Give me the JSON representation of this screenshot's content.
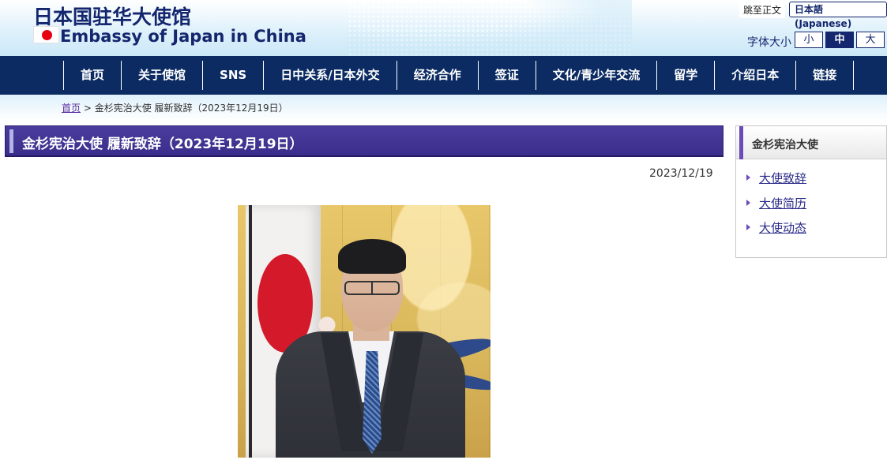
{
  "header": {
    "title_cn": "日本国驻华大使馆",
    "title_en": "Embassy of Japan in China",
    "skip_link": "跳至正文",
    "lang_button": "日本語 (Japanese)",
    "font_size_label": "字体大小",
    "font_sizes": [
      "小",
      "中",
      "大"
    ]
  },
  "nav": {
    "items": [
      "首页",
      "关于使馆",
      "SNS",
      "日中关系/日本外交",
      "经济合作",
      "签证",
      "文化/青少年交流",
      "留学",
      "介绍日本",
      "链接"
    ]
  },
  "breadcrumb": {
    "home": "首页",
    "separator": ">",
    "current": "金杉宪治大使 履新致辞（2023年12月19日）"
  },
  "main": {
    "heading": "金杉宪治大使 履新致辞（2023年12月19日）",
    "date": "2023/12/19"
  },
  "sidebar": {
    "title": "金杉宪治大使",
    "items": [
      "大使致辞",
      "大使简历",
      "大使动态"
    ]
  },
  "colors": {
    "navy": "#0b2b62",
    "heading_purple": "#3a2e8c",
    "accent_purple": "#6a4bb8",
    "flag_red": "#e60012"
  }
}
